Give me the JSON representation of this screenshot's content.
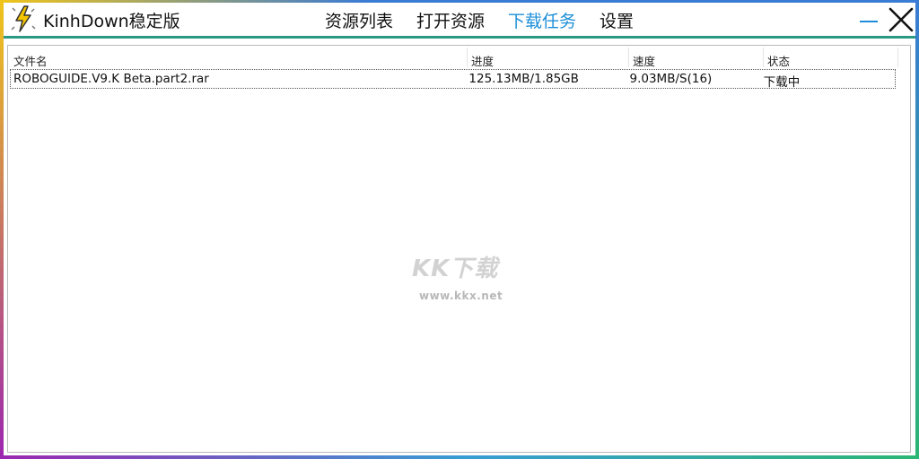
{
  "app": {
    "title": "KinhDown稳定版"
  },
  "nav": {
    "items": [
      {
        "label": "资源列表",
        "active": false
      },
      {
        "label": "打开资源",
        "active": false
      },
      {
        "label": "下载任务",
        "active": true
      },
      {
        "label": "设置",
        "active": false
      }
    ]
  },
  "table": {
    "columns": [
      "文件名",
      "进度",
      "速度",
      "状态"
    ],
    "rows": [
      {
        "filename": "ROBOGUIDE.V9.K Beta.part2.rar",
        "progress": "125.13MB/1.85GB",
        "speed": "9.03MB/S(16)",
        "status": "下载中"
      }
    ]
  },
  "watermark": {
    "logo_text": "KK下载",
    "url": "www.kkx.net"
  },
  "colors": {
    "accent": "#1d8fd8",
    "divider": "#2a9a85",
    "logo_bolt": "#f5c400"
  },
  "icons": {
    "logo": "lightning-bolt-icon",
    "minimize": "minimize-icon",
    "close": "close-icon"
  }
}
